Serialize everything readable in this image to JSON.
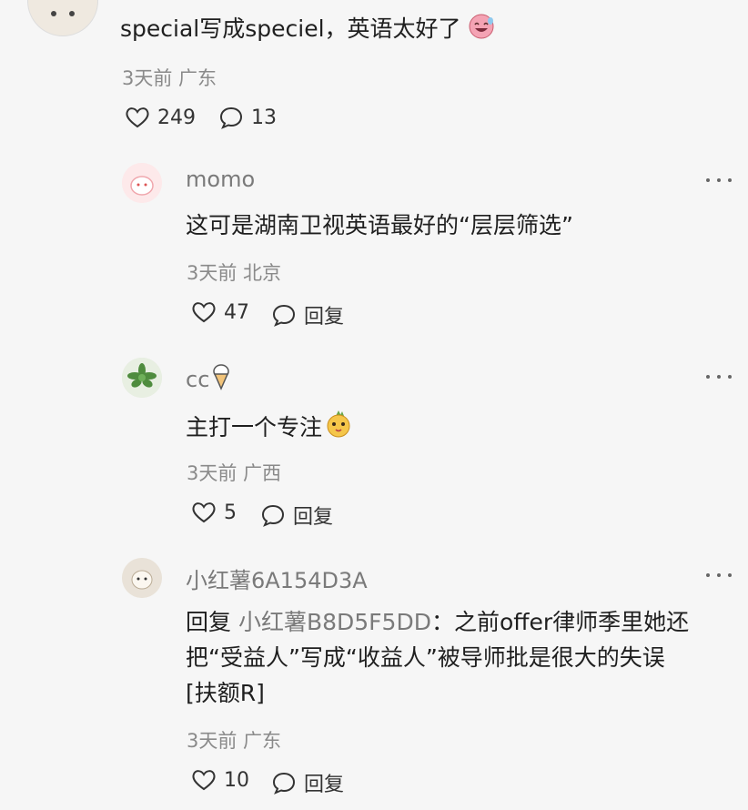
{
  "top_comment": {
    "text": "special写成speciel，英语太好了",
    "meta": "3天前 广东",
    "likes": "249",
    "replies": "13",
    "emoji_icon": "laughing-face-icon"
  },
  "replies": [
    {
      "username": "momo",
      "text": "这可是湖南卫视英语最好的“层层筛选”",
      "meta": "3天前 北京",
      "likes": "47",
      "reply_label": "回复"
    },
    {
      "username": "cc",
      "username_icon": "ice-cream-icon",
      "text": "主打一个专注",
      "text_icon": "pineapple-face-icon",
      "meta": "3天前 广西",
      "likes": "5",
      "reply_label": "回复"
    },
    {
      "username": "小红薯6A154D3A",
      "reply_prefix": "回复",
      "reply_target": "小红薯B8D5F5DD",
      "text_line1": "：之前offer律师季里她还",
      "text_line2": "把“受益人”写成“收益人”被导师批是很大的失误",
      "text_line3": "[扶额R]",
      "meta": "3天前 广东",
      "likes": "10",
      "reply_label": "回复"
    }
  ],
  "colors": {
    "background": "#f6f6f6",
    "text": "#1f1f1f",
    "meta": "#8a8a8a"
  }
}
